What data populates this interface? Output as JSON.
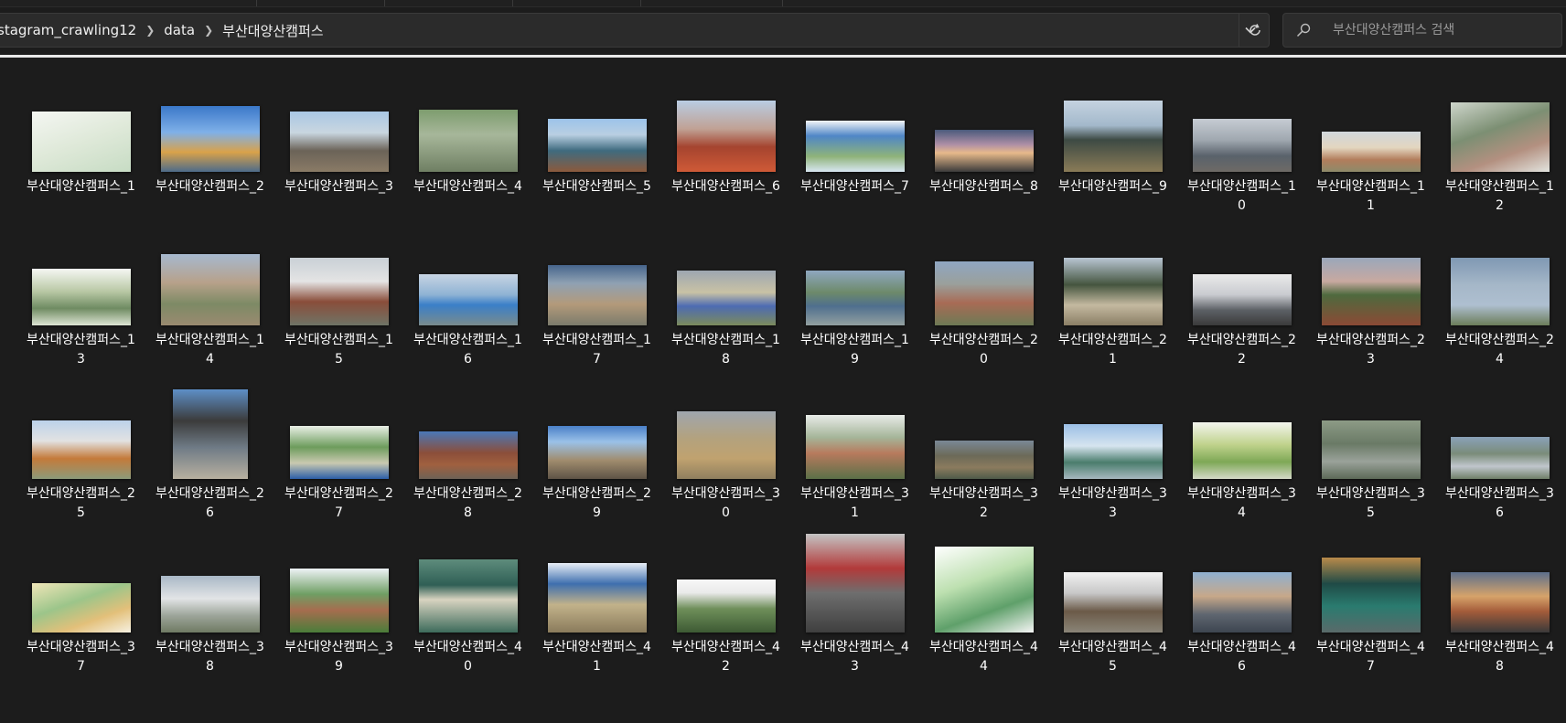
{
  "breadcrumb": [
    "stagram_crawling12",
    "data",
    "부산대양산캠퍼스"
  ],
  "search": {
    "placeholder": "부산대양산캠퍼스 검색"
  },
  "files": [
    {
      "name": "부산대양산캠퍼스_1"
    },
    {
      "name": "부산대양산캠퍼스_2"
    },
    {
      "name": "부산대양산캠퍼스_3"
    },
    {
      "name": "부산대양산캠퍼스_4"
    },
    {
      "name": "부산대양산캠퍼스_5"
    },
    {
      "name": "부산대양산캠퍼스_6"
    },
    {
      "name": "부산대양산캠퍼스_7"
    },
    {
      "name": "부산대양산캠퍼스_8"
    },
    {
      "name": "부산대양산캠퍼스_9"
    },
    {
      "name": "부산대양산캠퍼스_10"
    },
    {
      "name": "부산대양산캠퍼스_11"
    },
    {
      "name": "부산대양산캠퍼스_12"
    },
    {
      "name": "부산대양산캠퍼스_13"
    },
    {
      "name": "부산대양산캠퍼스_14"
    },
    {
      "name": "부산대양산캠퍼스_15"
    },
    {
      "name": "부산대양산캠퍼스_16"
    },
    {
      "name": "부산대양산캠퍼스_17"
    },
    {
      "name": "부산대양산캠퍼스_18"
    },
    {
      "name": "부산대양산캠퍼스_19"
    },
    {
      "name": "부산대양산캠퍼스_20"
    },
    {
      "name": "부산대양산캠퍼스_21"
    },
    {
      "name": "부산대양산캠퍼스_22"
    },
    {
      "name": "부산대양산캠퍼스_23"
    },
    {
      "name": "부산대양산캠퍼스_24"
    },
    {
      "name": "부산대양산캠퍼스_25"
    },
    {
      "name": "부산대양산캠퍼스_26"
    },
    {
      "name": "부산대양산캠퍼스_27"
    },
    {
      "name": "부산대양산캠퍼스_28"
    },
    {
      "name": "부산대양산캠퍼스_29"
    },
    {
      "name": "부산대양산캠퍼스_30"
    },
    {
      "name": "부산대양산캠퍼스_31"
    },
    {
      "name": "부산대양산캠퍼스_32"
    },
    {
      "name": "부산대양산캠퍼스_33"
    },
    {
      "name": "부산대양산캠퍼스_34"
    },
    {
      "name": "부산대양산캠퍼스_35"
    },
    {
      "name": "부산대양산캠퍼스_36"
    },
    {
      "name": "부산대양산캠퍼스_37"
    },
    {
      "name": "부산대양산캠퍼스_38"
    },
    {
      "name": "부산대양산캠퍼스_39"
    },
    {
      "name": "부산대양산캠퍼스_40"
    },
    {
      "name": "부산대양산캠퍼스_41"
    },
    {
      "name": "부산대양산캠퍼스_42"
    },
    {
      "name": "부산대양산캠퍼스_43"
    },
    {
      "name": "부산대양산캠퍼스_44"
    },
    {
      "name": "부산대양산캠퍼스_45"
    },
    {
      "name": "부산대양산캠퍼스_46"
    },
    {
      "name": "부산대양산캠퍼스_47"
    },
    {
      "name": "부산대양산캠퍼스_48"
    }
  ]
}
